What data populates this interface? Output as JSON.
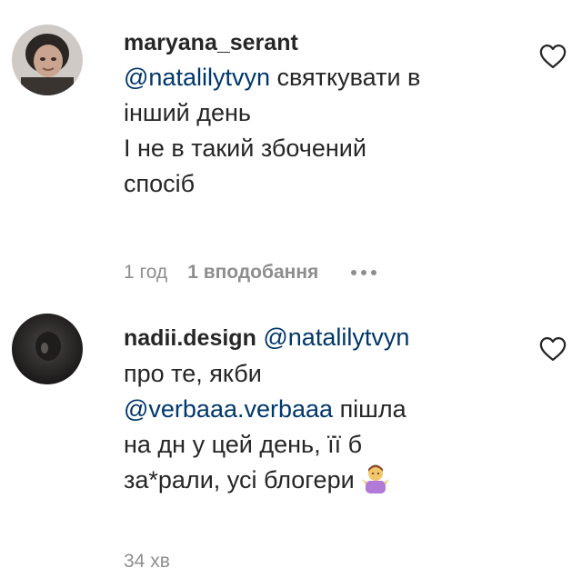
{
  "comments": [
    {
      "username": "maryana_serant",
      "mention": "@natalilytvyn",
      "lines_after_mention": " святкувати в",
      "lines": [
        "інший день",
        "І не в такий збочений",
        "спосіб"
      ],
      "time": "1 год",
      "likes": "1 вподобання",
      "avatar_icon": "profile-photo",
      "heart_icon": "heart-outline-icon"
    },
    {
      "username": "nadii.design",
      "mention": "@natalilytvyn",
      "line2": "про те, якби",
      "mention2": "@verbaaa.verbaaa",
      "line3_after_mention": " пішла",
      "lines": [
        "на дн у цей день, її б",
        "за*рали, усі блогери"
      ],
      "emoji": "person-shrugging",
      "time": "34 хв",
      "avatar_icon": "profile-photo",
      "heart_icon": "heart-outline-icon"
    }
  ],
  "colors": {
    "text": "#262626",
    "mention": "#00376b",
    "secondary": "#8e8e8e"
  }
}
